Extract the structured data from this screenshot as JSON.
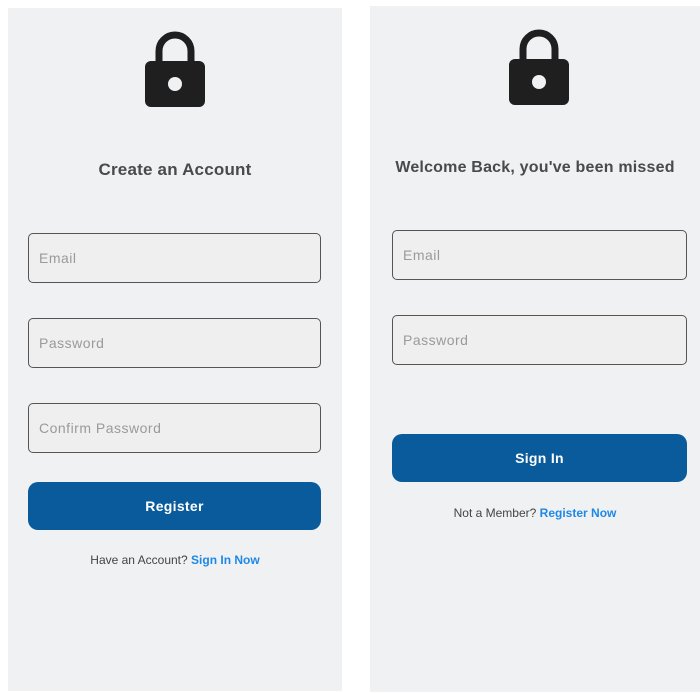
{
  "register": {
    "lock_icon": "lock-icon",
    "title": "Create an Account",
    "email_placeholder": "Email",
    "password_placeholder": "Password",
    "confirm_password_placeholder": "Confirm Password",
    "submit_label": "Register",
    "footer_text": "Have an Account?",
    "footer_link": "Sign In Now"
  },
  "login": {
    "lock_icon": "lock-icon",
    "title": "Welcome Back, you've been missed",
    "email_placeholder": "Email",
    "password_placeholder": "Password",
    "submit_label": "Sign In",
    "footer_text": "Not a Member?",
    "footer_link": "Register Now"
  },
  "colors": {
    "screen_background": "#f0f1f3",
    "primary_button": "#0a5b9c",
    "link": "#1e88e5",
    "field_background": "#efefef",
    "icon": "#1f1f1f"
  }
}
